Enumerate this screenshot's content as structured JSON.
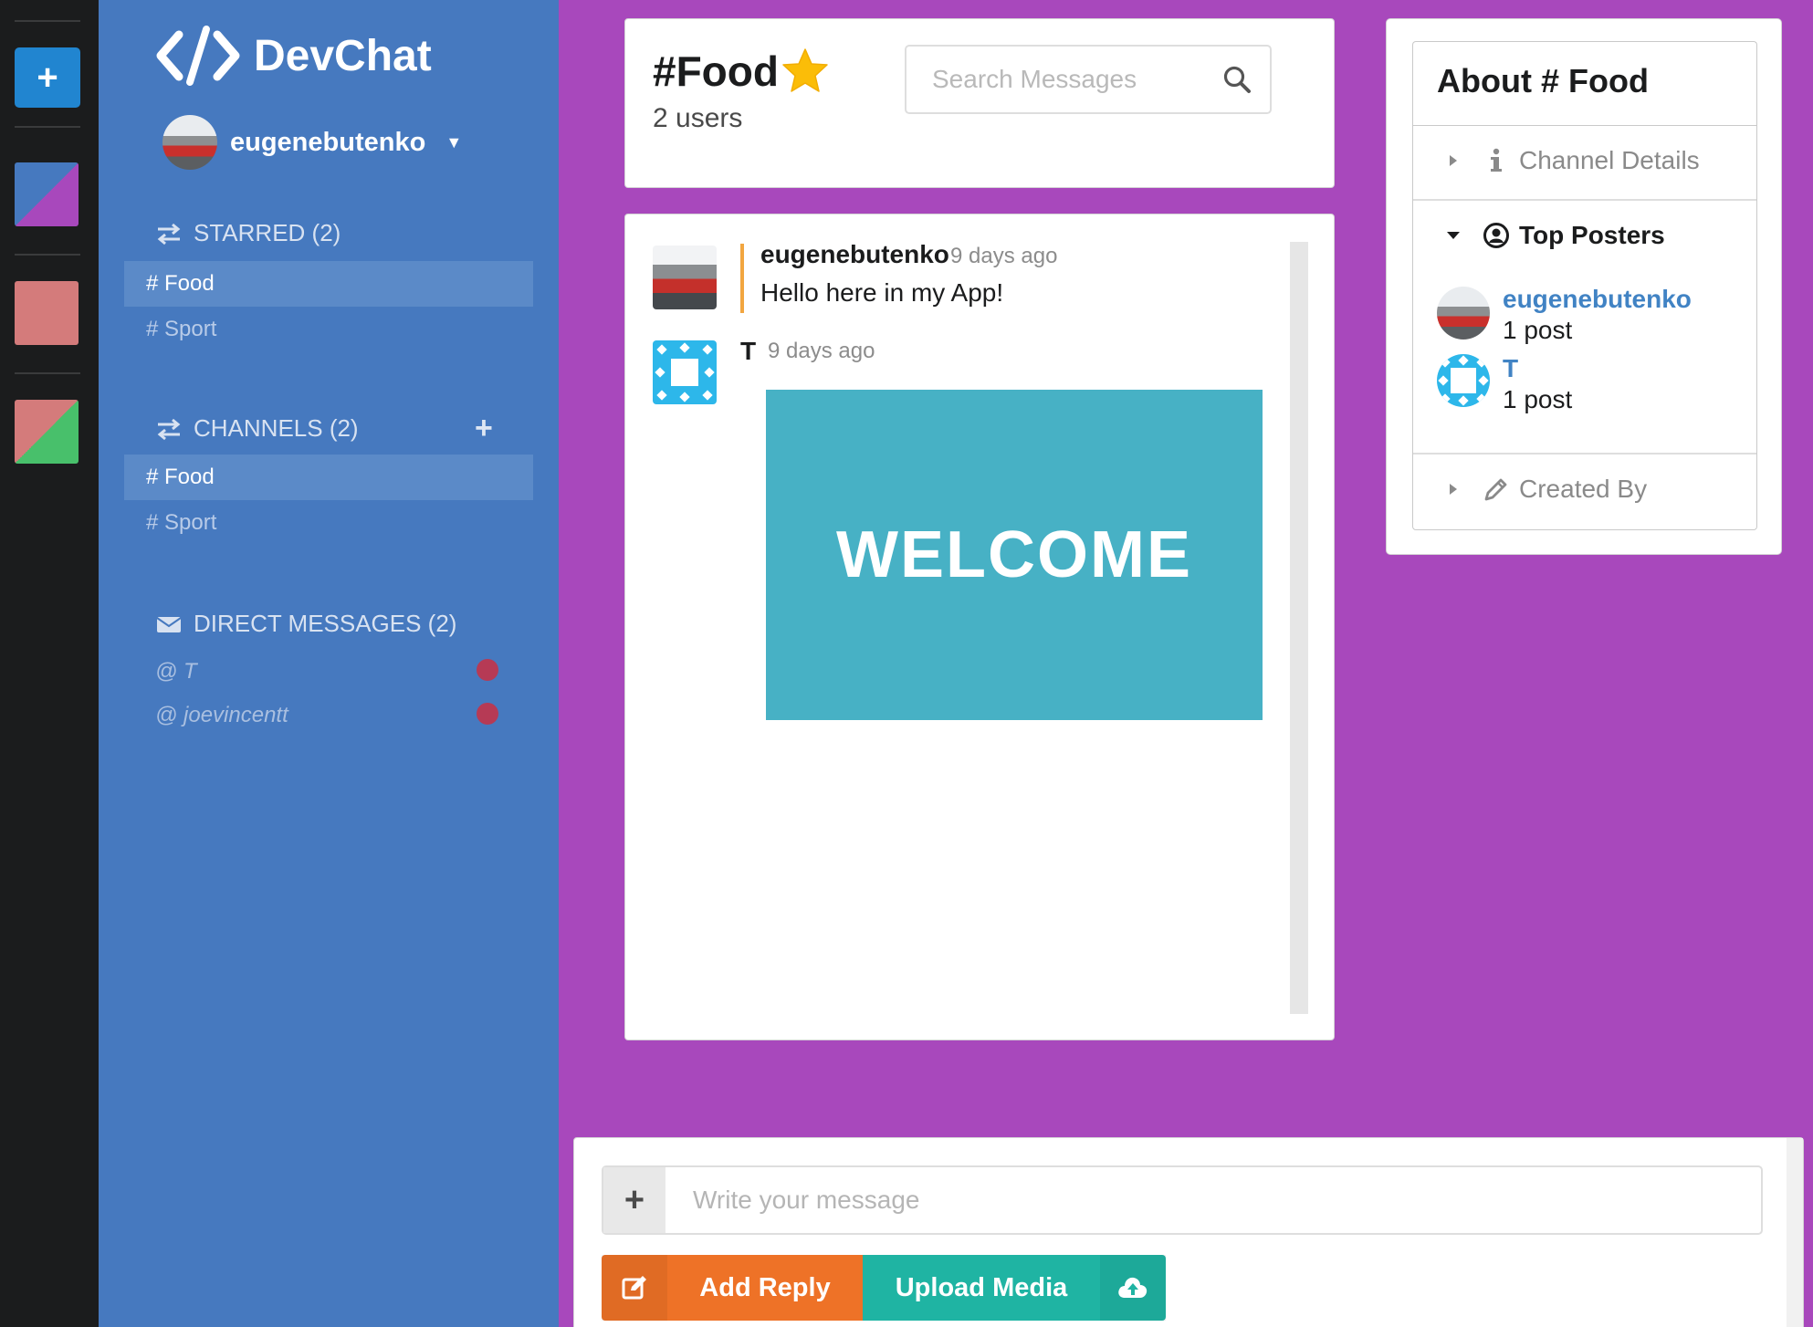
{
  "app": {
    "name": "DevChat"
  },
  "user": {
    "name": "eugenebutenko"
  },
  "colors": {
    "color_panel": "#1b1c1d",
    "side_panel": "#4679bf",
    "main_bg": "#a848bc",
    "accent_star": "#fbbd08",
    "reply": "#ee7227",
    "upload": "#1fb4a3",
    "welcome_bg": "#47b1c5"
  },
  "color_panel": {
    "add_icon": "plus-icon",
    "swatches": [
      {
        "primary": "#a848bc",
        "secondary": "#4679bf"
      },
      {
        "primary": "#d47b7b",
        "secondary": "#d47b7b"
      },
      {
        "primary": "#48c06b",
        "secondary": "#d47b7b"
      }
    ]
  },
  "starred": {
    "heading": "STARRED (2)",
    "items": [
      "# Food",
      "# Sport"
    ],
    "active": "# Food"
  },
  "channels": {
    "heading": "CHANNELS (2)",
    "items": [
      "# Food",
      "# Sport"
    ],
    "active": "# Food"
  },
  "direct_messages": {
    "heading": "DIRECT MESSAGES (2)",
    "items": [
      {
        "name": "@ T",
        "status": "offline"
      },
      {
        "name": "@ joevincentt",
        "status": "offline"
      }
    ]
  },
  "header": {
    "channel": "#Food",
    "starred": true,
    "users": "2 users",
    "search_placeholder": "Search Messages"
  },
  "messages": [
    {
      "author": "eugenebutenko",
      "time": "9 days ago",
      "text": "Hello here in my App!",
      "own": true
    },
    {
      "author": "T",
      "time": "9 days ago",
      "image_text": "WELCOME",
      "own": false
    }
  ],
  "meta": {
    "title": "About # Food",
    "sections": {
      "details": "Channel Details",
      "top_posters": "Top Posters",
      "created_by": "Created By"
    },
    "posters": [
      {
        "name": "eugenebutenko",
        "count": "1 post"
      },
      {
        "name": "T",
        "count": "1 post"
      }
    ]
  },
  "form": {
    "placeholder": "Write your message",
    "reply_label": "Add Reply",
    "upload_label": "Upload Media"
  }
}
